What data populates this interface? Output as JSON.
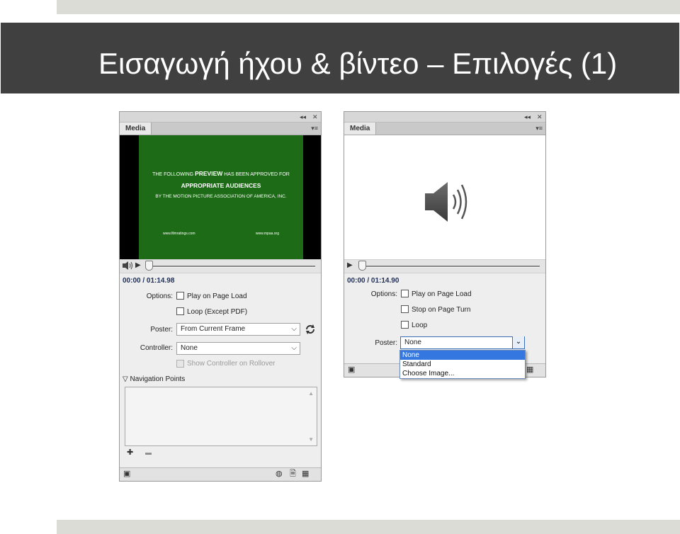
{
  "slide": {
    "title": "Εισαγωγή ήχου & βίντεο – Επιλογές (1)"
  },
  "panel_video": {
    "tab_label": "Media",
    "collapse_glyph": "◂◂",
    "close_glyph": "✕",
    "menu_glyph": "▾≡",
    "video_text": {
      "line1_pre": "THE FOLLOWING",
      "line1_bold": "PREVIEW",
      "line1_post": "HAS BEEN APPROVED FOR",
      "line2": "APPROPRIATE AUDIENCES",
      "line3": "BY THE MOTION PICTURE ASSOCIATION OF AMERICA, INC.",
      "url_left": "www.filmratings.com",
      "url_right": "www.mpaa.org"
    },
    "time": "00:00 / 01:14.98",
    "options_label": "Options:",
    "option_play": "Play on Page Load",
    "option_loop": "Loop (Except PDF)",
    "poster_label": "Poster:",
    "poster_value": "From Current Frame",
    "controller_label": "Controller:",
    "controller_value": "None",
    "show_controller": "Show Controller on Rollover",
    "nav_points": "Navigation Points",
    "add_glyph": "✚",
    "remove_glyph": "▬"
  },
  "panel_audio": {
    "tab_label": "Media",
    "collapse_glyph": "◂◂",
    "close_glyph": "✕",
    "menu_glyph": "▾≡",
    "time": "00:00 / 01:14.90",
    "options_label": "Options:",
    "option_play": "Play on Page Load",
    "option_stop": "Stop on Page Turn",
    "option_loop": "Loop",
    "poster_label": "Poster:",
    "poster_value": "None",
    "dropdown_options": [
      "None",
      "Standard",
      "Choose Image..."
    ],
    "dropdown_selected": "None"
  },
  "colors": {
    "title_bar": "#404040",
    "video_bg": "#1d6a17",
    "selection": "#3577e0"
  }
}
